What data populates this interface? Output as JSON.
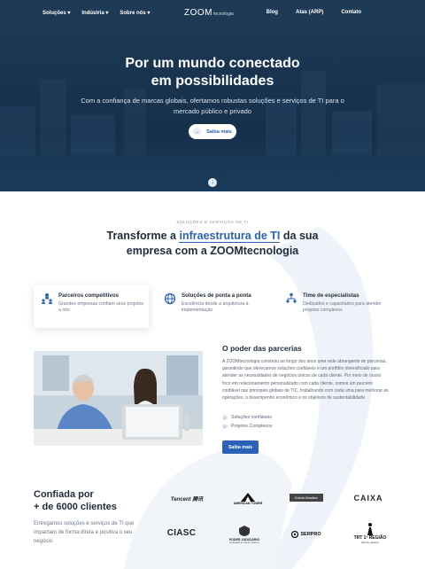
{
  "nav": {
    "left": [
      "Soluções ▾",
      "Indústria ▾",
      "Sobre nós ▾"
    ],
    "brand": "ZOOM",
    "brand_sub": "tecnologia",
    "right": [
      "Blog",
      "Atas (ARP)",
      "Contato"
    ]
  },
  "hero": {
    "title_line1": "Por um mundo conectado",
    "title_line2": "em possibilidades",
    "subtitle": "Com a confiança de marcas globais, ofertamos robustas soluções e serviços de TI para o mercado público e privado",
    "cta": "Saiba mais"
  },
  "services": {
    "eyebrow": "SOLUÇÕES E SERVIÇOS DE TI",
    "title_pre": "Transforme a ",
    "title_highlight": "infraestrutura de TI",
    "title_post": " da sua",
    "title_line2": "empresa com a ZOOMtecnologia",
    "features": [
      {
        "title": "Parceiros competitivos",
        "desc": "Grandes empresas confiam seus projetos a nós",
        "icon": "people-network-icon"
      },
      {
        "title": "Soluções de ponta a ponta",
        "desc": "Excelência desde a arquitetura à implementação",
        "icon": "globe-icon"
      },
      {
        "title": "Time de especialistas",
        "desc": "Dedicados e capacitados para atender projetos complexos",
        "icon": "team-hierarchy-icon"
      }
    ]
  },
  "partners": {
    "title": "O poder das parcerias",
    "text": "A ZOOMtecnologia construiu ao longo dos anos uma rede abrangente de parcerias, garantindo que ofereçamos soluções confiáveis e um portfólio diversificado para atender as necessidades de negócios únicos de cada cliente. Por meio de nosso foco em relacionamento personalizado com cada cliente, somos um parceiro confiável nas principais globais de TIC, trabalhando com cada uma para melhorar as operações, o desempenho econômico e os objetivos de sustentabilidade.",
    "checks": [
      "Soluções confiáveis",
      "Projetos Complexos"
    ],
    "cta": "Saiba mais"
  },
  "trust": {
    "title_line1": "Confiada por",
    "title_line2": "+ de 6000 clientes",
    "text": "Entregamos soluções e serviços de TI que impactam de forma direta e positiva o seu negócio."
  },
  "clients": {
    "tencent": "Tencent 腾讯",
    "americantower": "AMERICAN TOWER",
    "exercito": "Exército Brasileiro",
    "caixa": "CAIXA",
    "ciasc": "CIASC",
    "judiciario": "PODER JUDICIÁRIO",
    "judiciario_sub": "do Estado de Santa Catarina",
    "serpro": "SERPRO",
    "trt": "TRT 1ª REGIÃO",
    "trt_sub": "Rio de Janeiro"
  }
}
